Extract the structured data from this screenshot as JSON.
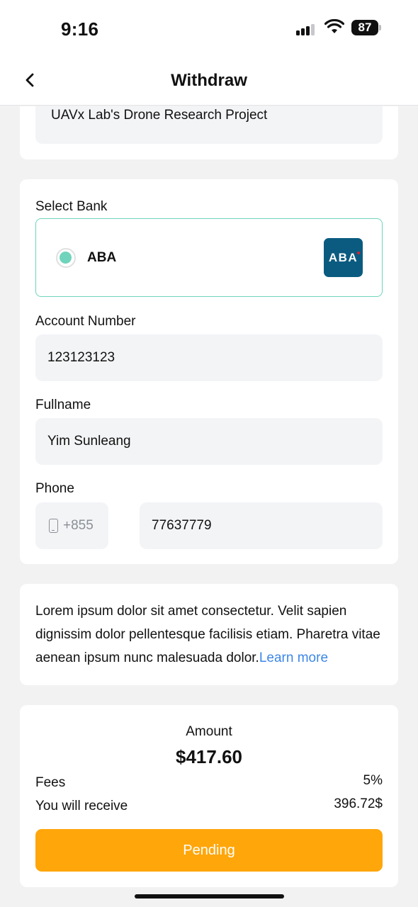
{
  "status_bar": {
    "time": "9:16",
    "battery": "87"
  },
  "nav": {
    "title": "Withdraw"
  },
  "project": {
    "name": "UAVx Lab's Drone Research Project"
  },
  "bank": {
    "section_label": "Select Bank",
    "selected_bank": "ABA",
    "logo_text": "ABA",
    "brand_color": "#0b5b80",
    "selected_color": "#6fd4bb"
  },
  "form": {
    "account_number_label": "Account Number",
    "account_number": "123123123",
    "fullname_label": "Fullname",
    "fullname": "Yim Sunleang",
    "phone_label": "Phone",
    "country_code": "+855",
    "phone": "77637779"
  },
  "info": {
    "text": "Lorem ipsum dolor sit amet consectetur. Velit sapien dignissim dolor pellentesque facilisis etiam. Pharetra vitae aenean ipsum nunc malesuada dolor.",
    "link": "Learn more"
  },
  "summary": {
    "amount_label": "Amount",
    "amount": "$417.60",
    "fees_label": "Fees",
    "fees": "5%",
    "receive_label": "You will receive",
    "receive": "396.72$",
    "button": "Pending",
    "button_color": "#ffa60a"
  }
}
